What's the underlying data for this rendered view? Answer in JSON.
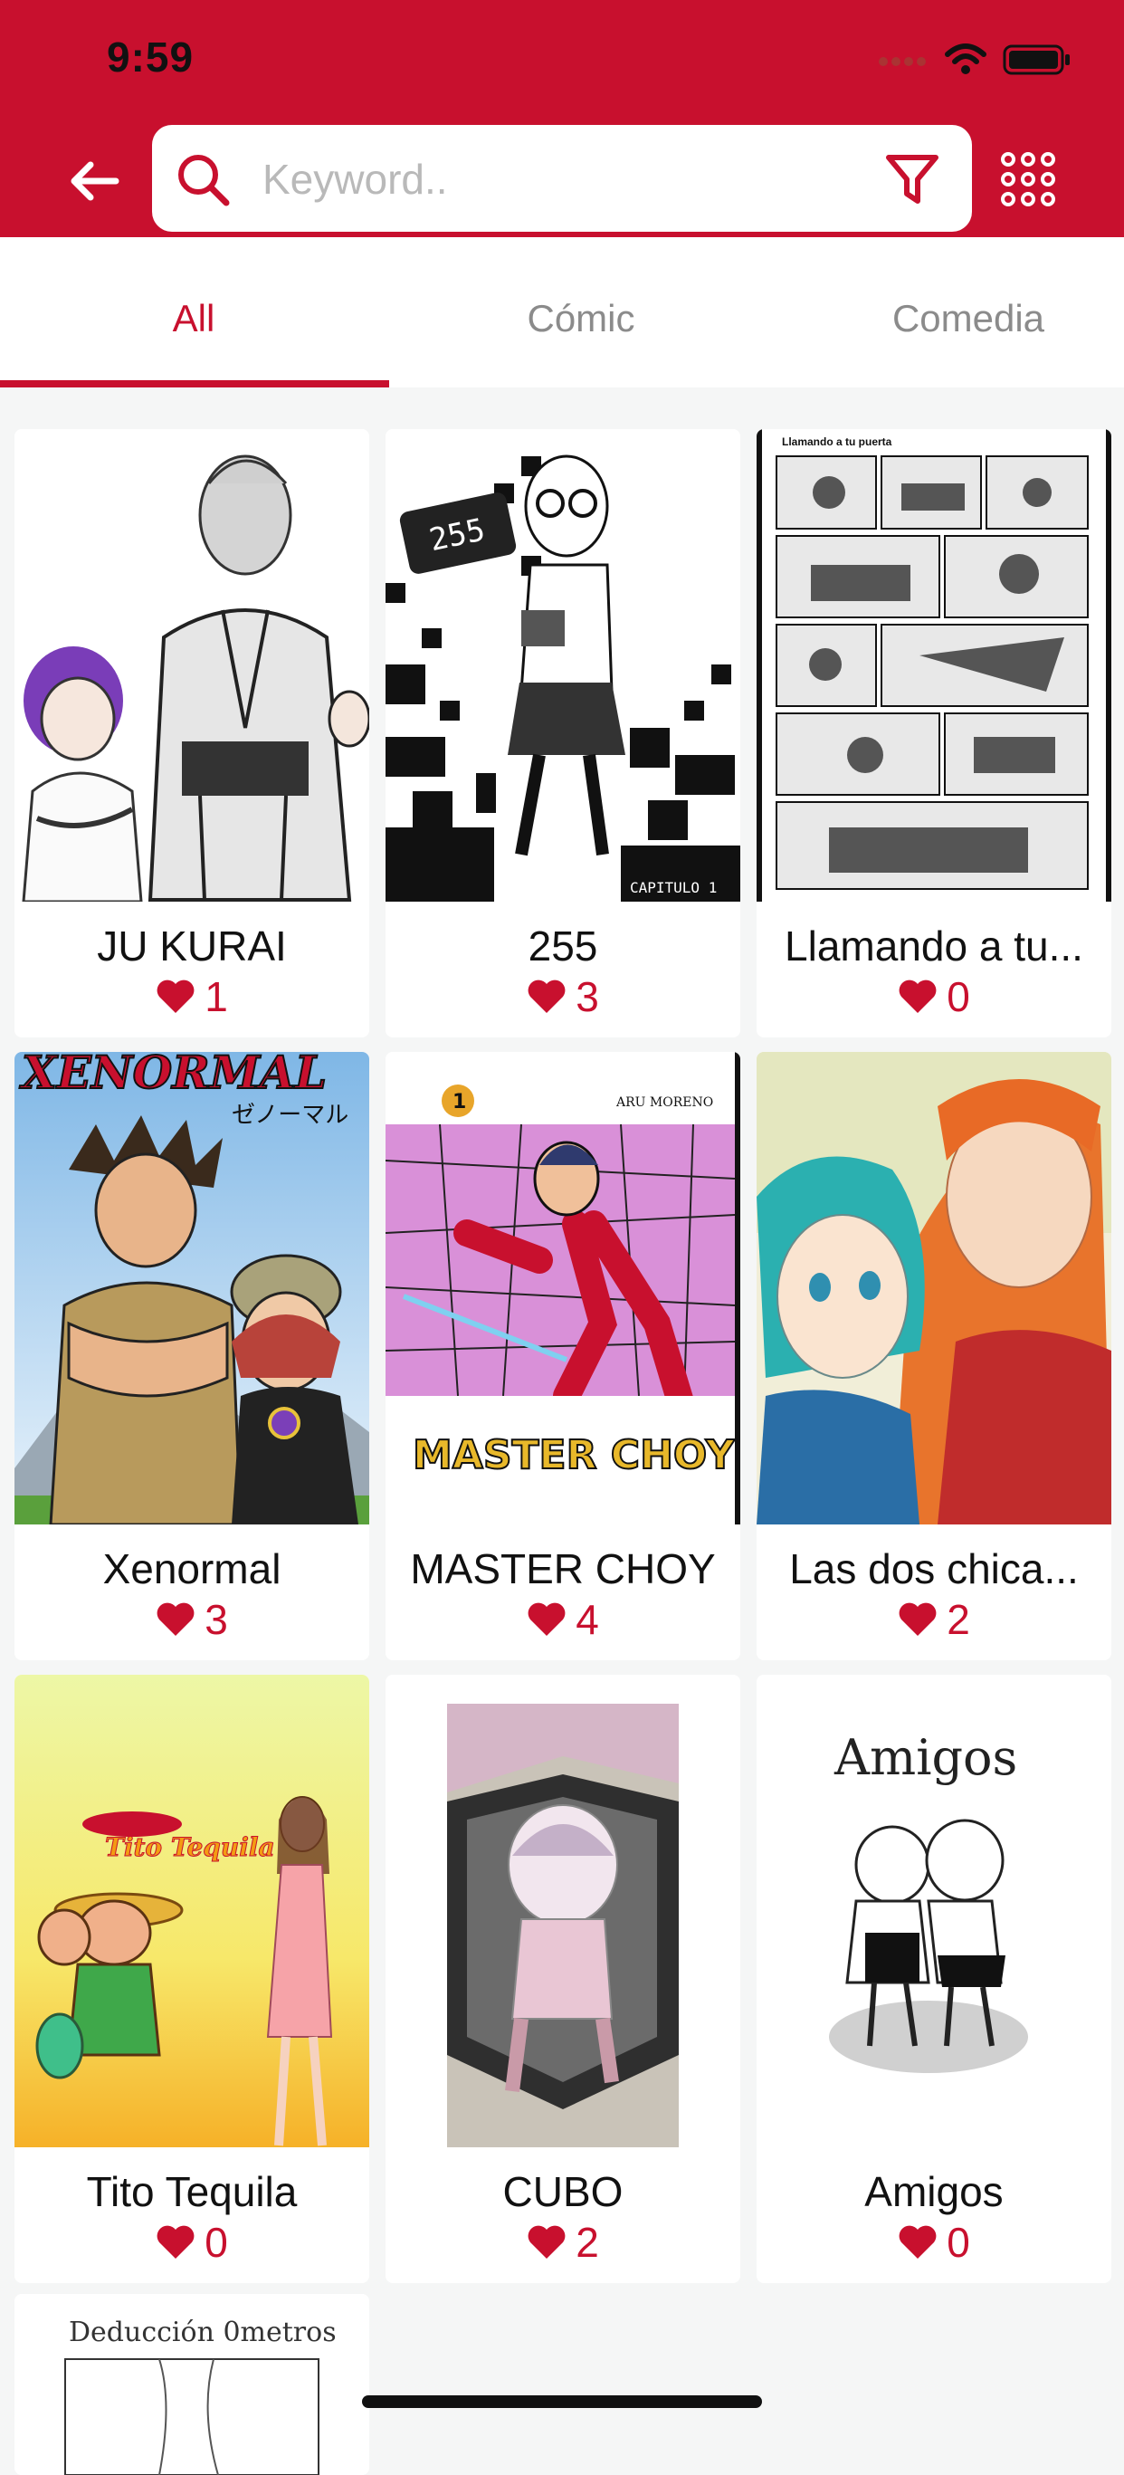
{
  "status_bar": {
    "time": "9:59"
  },
  "search": {
    "placeholder": "Keyword.."
  },
  "tabs": [
    {
      "label": "All",
      "active": true
    },
    {
      "label": "Cómic",
      "active": false
    },
    {
      "label": "Comedia",
      "active": false
    }
  ],
  "comics": [
    {
      "title": "JU KURAI",
      "likes": "1"
    },
    {
      "title": "255",
      "likes": "3"
    },
    {
      "title": "Llamando a tu...",
      "likes": "0"
    },
    {
      "title": "Xenormal",
      "likes": "3"
    },
    {
      "title": "MASTER CHOY",
      "likes": "4"
    },
    {
      "title": "Las dos chica...",
      "likes": "2"
    },
    {
      "title": "Tito Tequila",
      "likes": "0"
    },
    {
      "title": "CUBO",
      "likes": "2"
    },
    {
      "title": "Amigos",
      "likes": "0"
    }
  ],
  "cover_texts": {
    "c255": "255",
    "c255_chapter": "CAPITULO 1",
    "llamando": "Llamando a tu puerta",
    "xenormal": "XENORMAL",
    "xenormal_jp": "ゼノーマル",
    "master_author": "ARU MORENO",
    "master_num": "1",
    "master_logo": "MASTER CHOY",
    "tito": "Tito Tequila",
    "amigos": "Amigos",
    "partial": "Deducción 0metros"
  },
  "colors": {
    "brand": "#c8102e",
    "background": "#f5f6f6"
  }
}
